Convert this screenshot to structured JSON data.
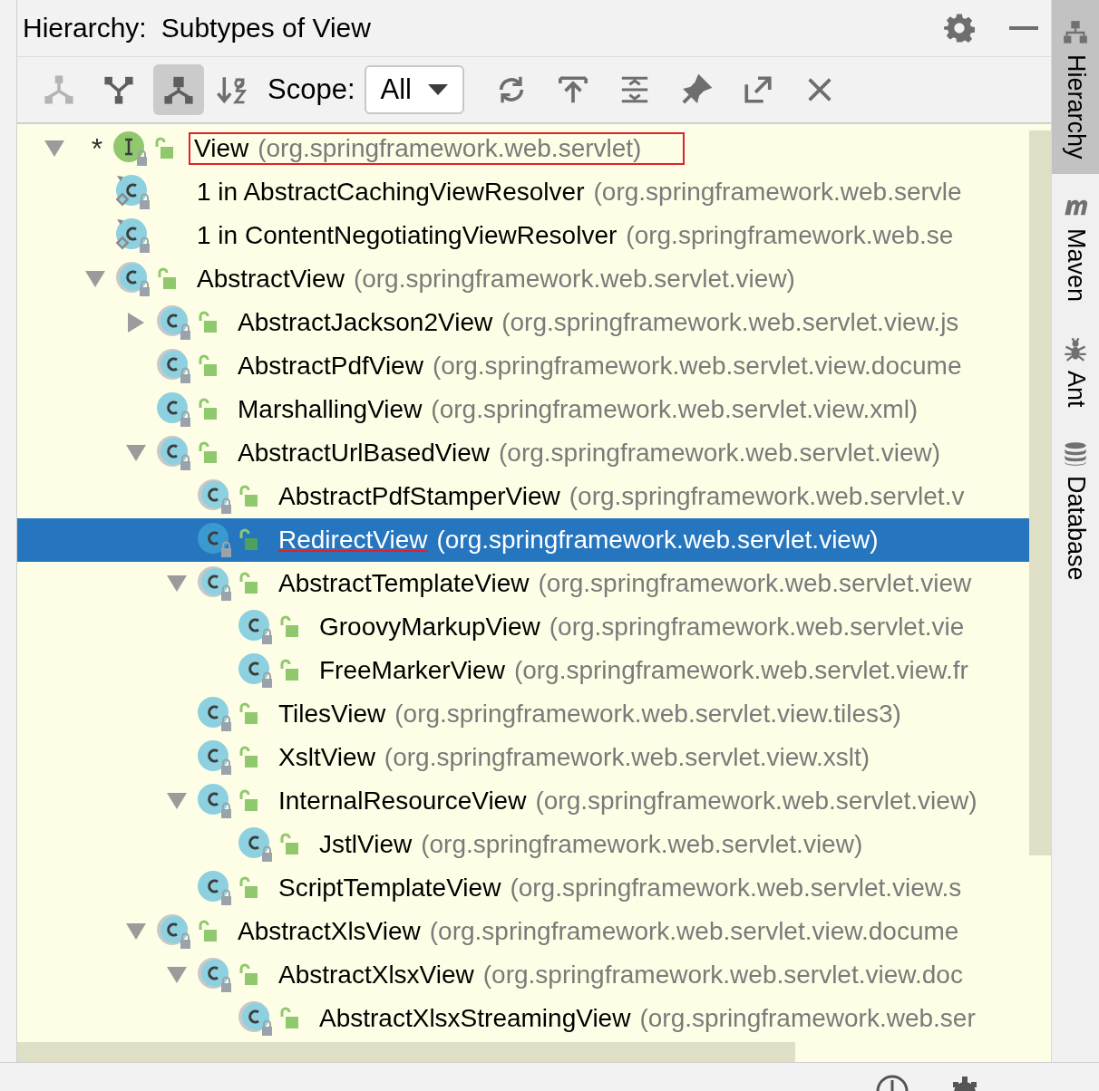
{
  "window": {
    "title": "Hierarchy:",
    "subtitle": "Subtypes of View"
  },
  "toolbar": {
    "buttons": [
      {
        "kind": "supertypes",
        "selected": false,
        "disabled": true
      },
      {
        "kind": "subtypes",
        "selected": false,
        "disabled": false
      },
      {
        "kind": "hierarchy",
        "selected": true,
        "disabled": false
      }
    ],
    "sort": {
      "kind": "sort-alpha"
    },
    "scope_label": "Scope:",
    "scope_value": "All",
    "actions": [
      {
        "kind": "refresh"
      },
      {
        "kind": "export"
      },
      {
        "kind": "expand"
      },
      {
        "kind": "pin"
      },
      {
        "kind": "open"
      },
      {
        "kind": "close"
      }
    ]
  },
  "tree": [
    {
      "kind": "interface",
      "marker": "*",
      "name": "View",
      "package": "(org.springframework.web.servlet)",
      "expanded": true,
      "selected": false,
      "outlined": true,
      "children": [
        {
          "kind": "anonymous",
          "name": "1 in AbstractCachingViewResolver",
          "package": "(org.springframework.web.servle",
          "selected": false
        },
        {
          "kind": "anonymous",
          "name": "1 in ContentNegotiatingViewResolver",
          "package": "(org.springframework.web.se",
          "selected": false
        },
        {
          "kind": "abstract",
          "name": "AbstractView",
          "package": "(org.springframework.web.servlet.view)",
          "expanded": true,
          "selected": false,
          "children": [
            {
              "kind": "abstract",
              "name": "AbstractJackson2View",
              "package": "(org.springframework.web.servlet.view.js",
              "expanded": false,
              "selected": false
            },
            {
              "kind": "abstract",
              "name": "AbstractPdfView",
              "package": "(org.springframework.web.servlet.view.docume",
              "selected": false
            },
            {
              "kind": "class",
              "name": "MarshallingView",
              "package": "(org.springframework.web.servlet.view.xml)",
              "selected": false
            },
            {
              "kind": "abstract",
              "name": "AbstractUrlBasedView",
              "package": "(org.springframework.web.servlet.view)",
              "expanded": true,
              "selected": false,
              "children": [
                {
                  "kind": "abstract",
                  "name": "AbstractPdfStamperView",
                  "package": "(org.springframework.web.servlet.v",
                  "selected": false
                },
                {
                  "kind": "class",
                  "name": "RedirectView",
                  "package": "(org.springframework.web.servlet.view)",
                  "selected": true,
                  "underlined": true
                },
                {
                  "kind": "abstract",
                  "name": "AbstractTemplateView",
                  "package": "(org.springframework.web.servlet.view",
                  "expanded": true,
                  "selected": false,
                  "children": [
                    {
                      "kind": "class",
                      "name": "GroovyMarkupView",
                      "package": "(org.springframework.web.servlet.vie",
                      "selected": false
                    },
                    {
                      "kind": "class",
                      "name": "FreeMarkerView",
                      "package": "(org.springframework.web.servlet.view.fr",
                      "selected": false
                    }
                  ]
                },
                {
                  "kind": "class",
                  "name": "TilesView",
                  "package": "(org.springframework.web.servlet.view.tiles3)",
                  "selected": false
                },
                {
                  "kind": "class",
                  "name": "XsltView",
                  "package": "(org.springframework.web.servlet.view.xslt)",
                  "selected": false
                },
                {
                  "kind": "class",
                  "name": "InternalResourceView",
                  "package": "(org.springframework.web.servlet.view)",
                  "expanded": true,
                  "selected": false,
                  "children": [
                    {
                      "kind": "class",
                      "name": "JstlView",
                      "package": "(org.springframework.web.servlet.view)",
                      "selected": false
                    }
                  ]
                },
                {
                  "kind": "class",
                  "name": "ScriptTemplateView",
                  "package": "(org.springframework.web.servlet.view.s",
                  "selected": false
                }
              ]
            },
            {
              "kind": "abstract",
              "name": "AbstractXlsView",
              "package": "(org.springframework.web.servlet.view.docume",
              "expanded": true,
              "selected": false,
              "children": [
                {
                  "kind": "abstract",
                  "name": "AbstractXlsxView",
                  "package": "(org.springframework.web.servlet.view.doc",
                  "expanded": true,
                  "selected": false,
                  "children": [
                    {
                      "kind": "abstract",
                      "name": "AbstractXlsxStreamingView",
                      "package": "(org.springframework.web.ser",
                      "selected": false
                    }
                  ]
                }
              ]
            }
          ]
        }
      ]
    }
  ],
  "sidebar": {
    "tabs": [
      {
        "kind": "hierarchy",
        "label": "Hierarchy",
        "selected": true
      },
      {
        "kind": "maven",
        "label": "Maven",
        "selected": false
      },
      {
        "kind": "ant",
        "label": "Ant",
        "selected": false
      },
      {
        "kind": "database",
        "label": "Database",
        "selected": false
      }
    ]
  }
}
